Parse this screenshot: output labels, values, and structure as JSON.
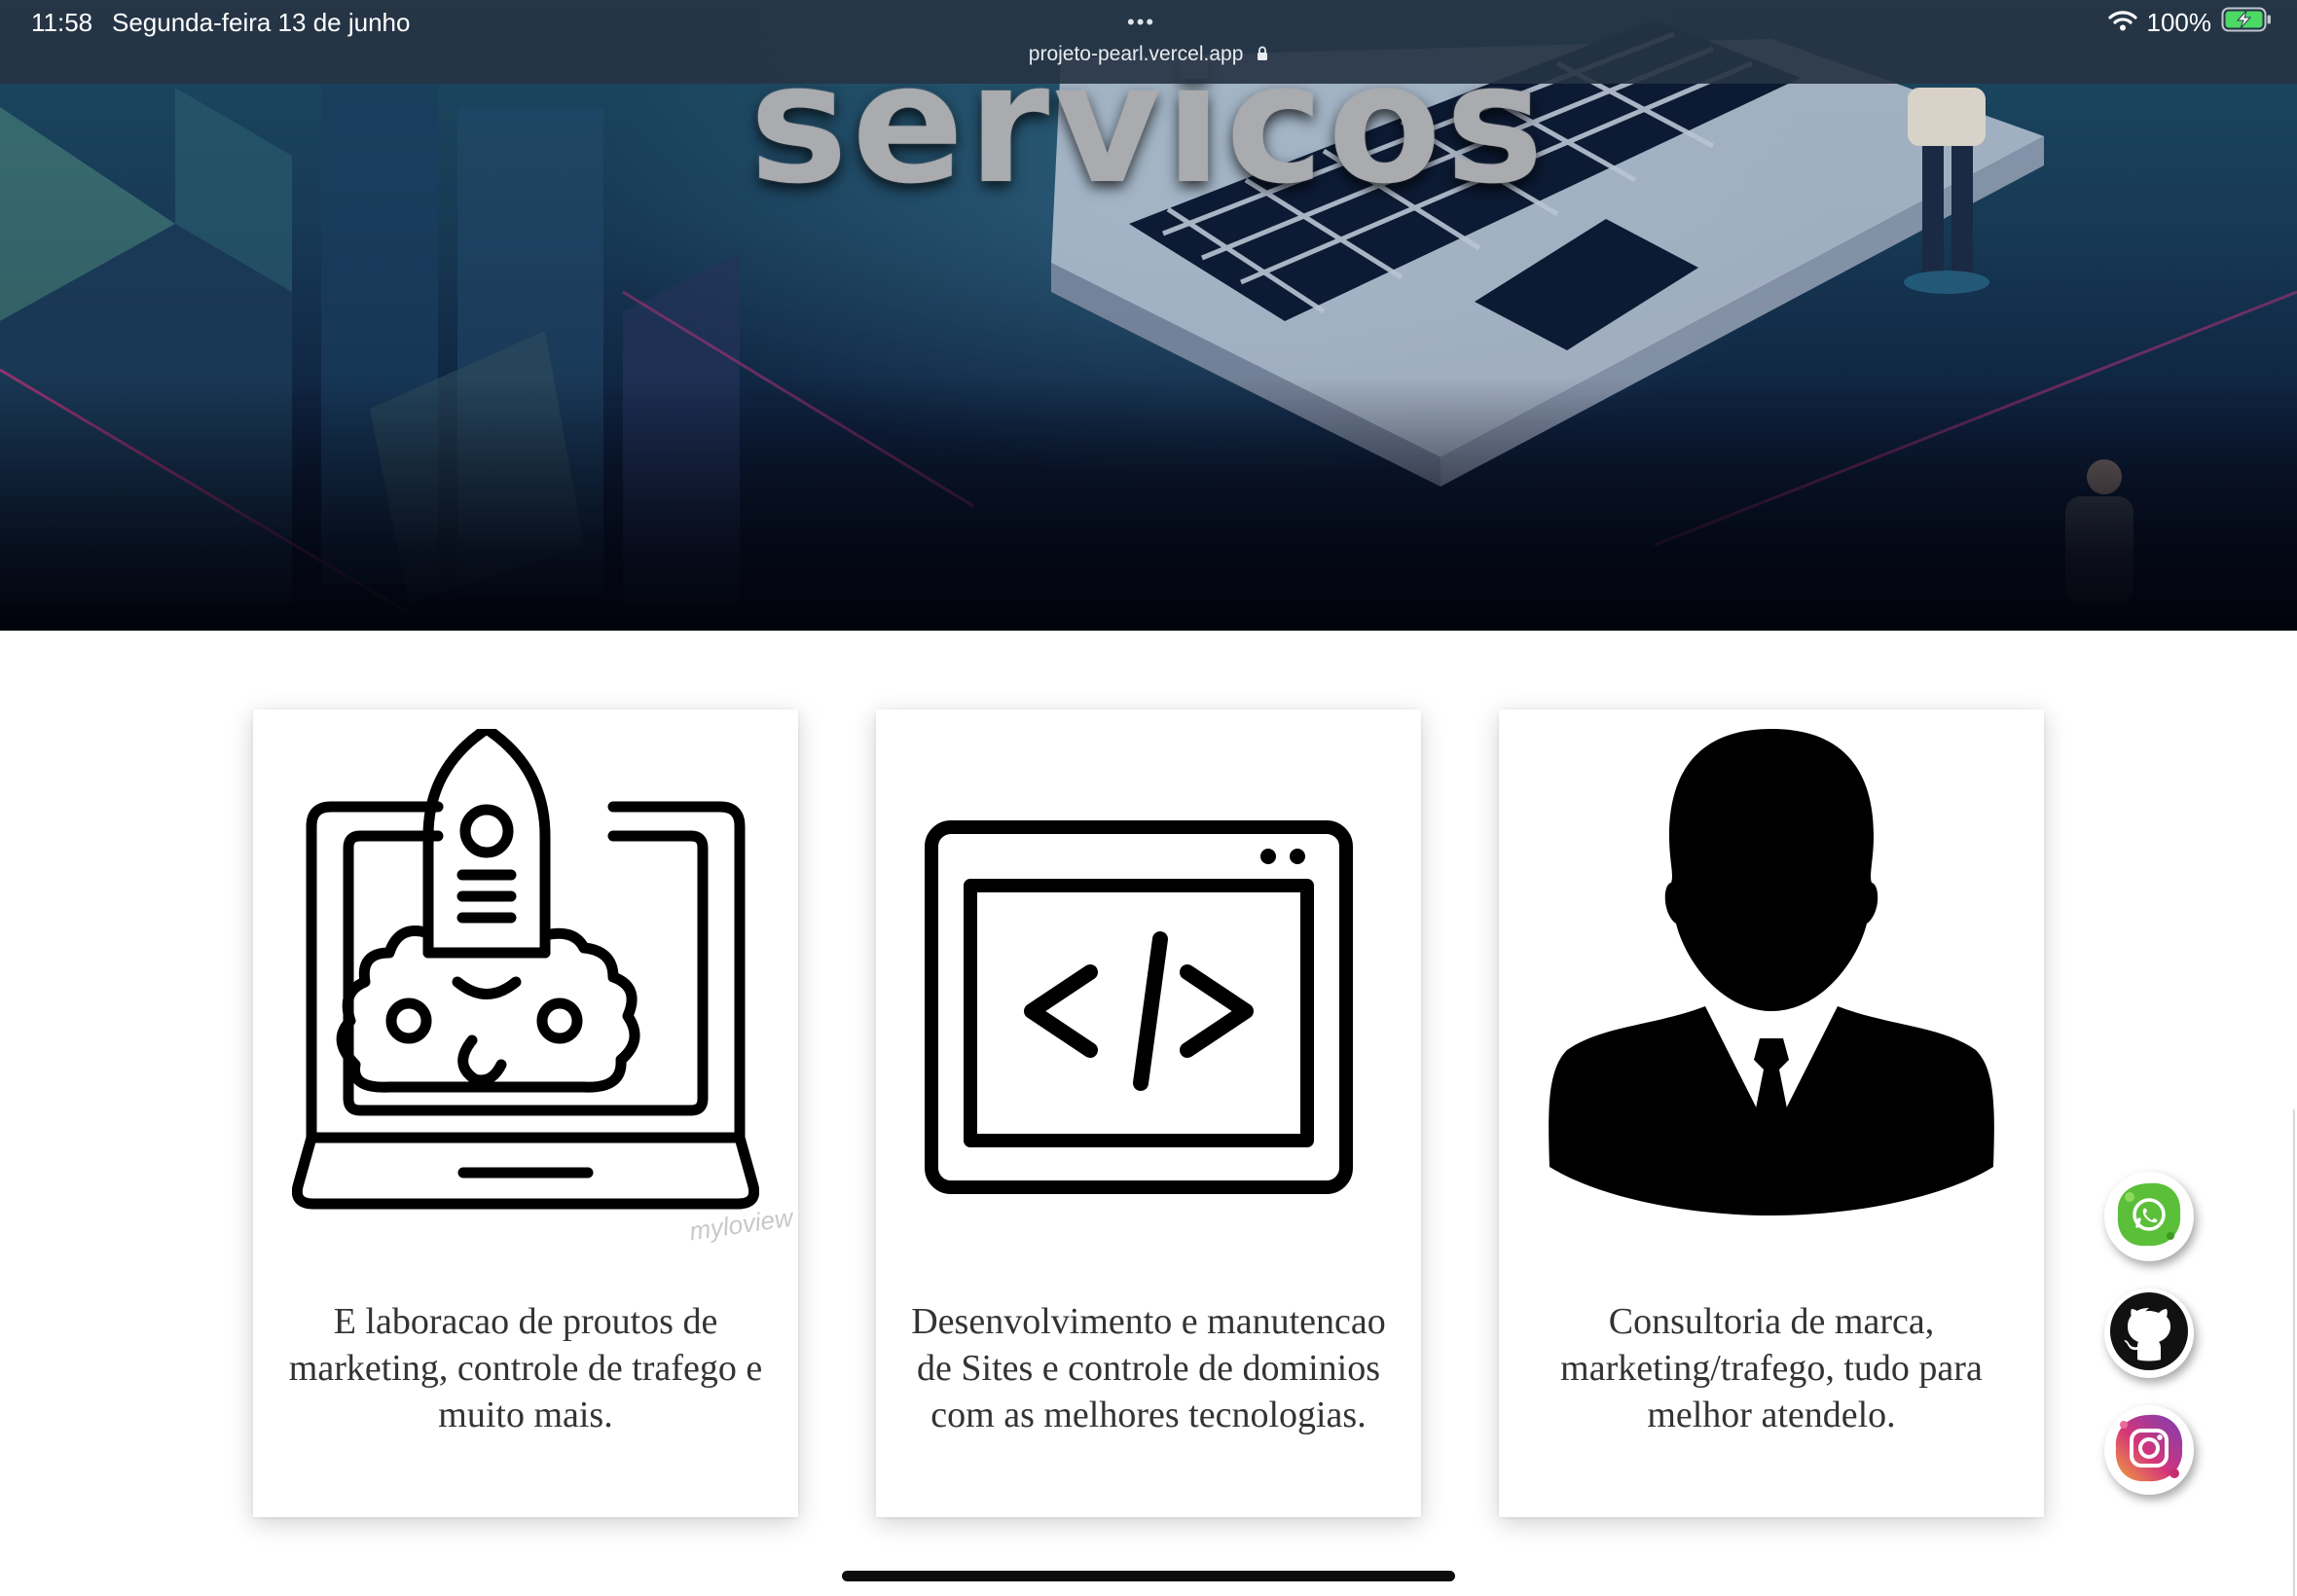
{
  "status_bar": {
    "time": "11:58",
    "date": "Segunda-feira 13 de junho",
    "dots": "•••",
    "url": "projeto-pearl.vercel.app",
    "battery": "100%",
    "icons": [
      "wifi-icon",
      "lock-icon",
      "battery-charging-icon"
    ]
  },
  "hero": {
    "title": "servicos"
  },
  "cards": [
    {
      "icon": "rocket-laptop-icon",
      "text": "E laboracao de proutos de marketing, controle de trafego e muito mais.",
      "watermark": "myloview"
    },
    {
      "icon": "code-window-icon",
      "text": "Desenvolvimento e manutencao de Sites e controle de dominios com as melhores tecnologias."
    },
    {
      "icon": "businessman-icon",
      "text": "Consultoria de marca, marketing/trafego, tudo para melhor atendelo."
    }
  ],
  "social_buttons": [
    {
      "icon": "whatsapp-icon",
      "color": "#5bbf3a"
    },
    {
      "icon": "github-icon",
      "color": "#111111"
    },
    {
      "icon": "instagram-icon",
      "color": "#d4357a"
    }
  ]
}
